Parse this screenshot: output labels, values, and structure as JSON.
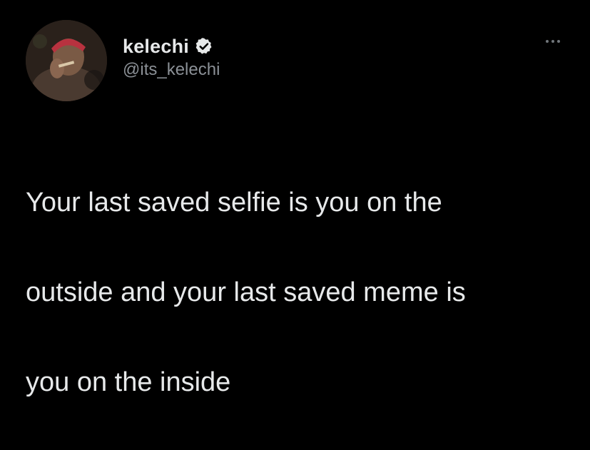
{
  "tweet": {
    "author": {
      "display_name": "kelechi",
      "handle": "@its_kelechi",
      "verified": true
    },
    "text_lines": [
      "Your last saved selfie is you on the",
      "outside and your last saved meme is",
      "you on the inside"
    ]
  },
  "icons": {
    "verified": "verified-badge-icon",
    "more": "more-horizontal-icon"
  },
  "colors": {
    "background": "#000000",
    "text_primary": "#e7e9ea",
    "text_secondary": "#8b9096"
  }
}
